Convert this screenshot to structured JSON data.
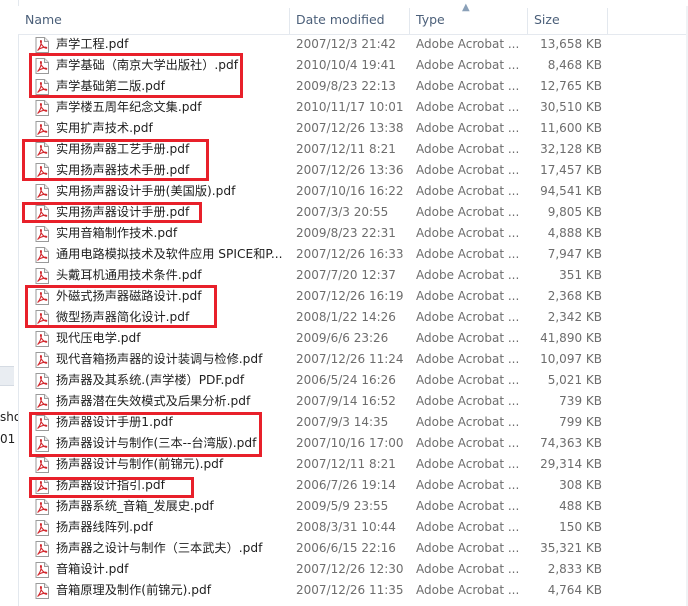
{
  "left_pane": {
    "fragment_1": "sho",
    "fragment_2": "01"
  },
  "columns": {
    "name": "Name",
    "date": "Date modified",
    "type": "Type",
    "size": "Size"
  },
  "files": [
    {
      "name": "声学工程.pdf",
      "date": "2007/12/3 21:42",
      "type": "Adobe Acrobat ...",
      "size": "13,658 KB"
    },
    {
      "name": "声学基础（南京大学出版社）.pdf",
      "date": "2010/10/4 19:41",
      "type": "Adobe Acrobat ...",
      "size": "8,468 KB"
    },
    {
      "name": "声学基础第二版.pdf",
      "date": "2009/8/23 22:13",
      "type": "Adobe Acrobat ...",
      "size": "12,765 KB"
    },
    {
      "name": "声学楼五周年纪念文集.pdf",
      "date": "2010/11/17 10:01",
      "type": "Adobe Acrobat ...",
      "size": "30,510 KB"
    },
    {
      "name": "实用扩声技术.pdf",
      "date": "2007/12/26 13:38",
      "type": "Adobe Acrobat ...",
      "size": "11,600 KB"
    },
    {
      "name": "实用扬声器工艺手册.pdf",
      "date": "2007/12/11 8:21",
      "type": "Adobe Acrobat ...",
      "size": "32,128 KB"
    },
    {
      "name": "实用扬声器技术手册.pdf",
      "date": "2007/12/26 13:36",
      "type": "Adobe Acrobat ...",
      "size": "17,457 KB"
    },
    {
      "name": "实用扬声器设计手册(美国版).pdf",
      "date": "2007/10/16 16:22",
      "type": "Adobe Acrobat ...",
      "size": "94,541 KB"
    },
    {
      "name": "实用扬声器设计手册.pdf",
      "date": "2007/3/3 20:55",
      "type": "Adobe Acrobat ...",
      "size": "9,805 KB"
    },
    {
      "name": "实用音箱制作技术.pdf",
      "date": "2009/8/23 22:31",
      "type": "Adobe Acrobat ...",
      "size": "4,888 KB"
    },
    {
      "name": "通用电路模拟技术及软件应用 SPICE和P...",
      "date": "2007/12/26 16:33",
      "type": "Adobe Acrobat ...",
      "size": "7,947 KB"
    },
    {
      "name": "头戴耳机通用技术条件.pdf",
      "date": "2007/7/20 12:37",
      "type": "Adobe Acrobat ...",
      "size": "351 KB"
    },
    {
      "name": "外磁式扬声器磁路设计.pdf",
      "date": "2007/12/26 16:19",
      "type": "Adobe Acrobat ...",
      "size": "2,368 KB"
    },
    {
      "name": "微型扬声器简化设计.pdf",
      "date": "2008/1/22 14:26",
      "type": "Adobe Acrobat ...",
      "size": "2,342 KB"
    },
    {
      "name": "现代压电学.pdf",
      "date": "2009/6/6 23:26",
      "type": "Adobe Acrobat ...",
      "size": "41,890 KB"
    },
    {
      "name": "现代音箱扬声器的设计装调与检修.pdf",
      "date": "2007/12/26 11:24",
      "type": "Adobe Acrobat ...",
      "size": "10,097 KB"
    },
    {
      "name": "扬声器及其系统.(声学楼）PDF.pdf",
      "date": "2006/5/24 16:26",
      "type": "Adobe Acrobat ...",
      "size": "5,021 KB"
    },
    {
      "name": "扬声器潜在失效模式及后果分析.pdf",
      "date": "2007/9/14 16:52",
      "type": "Adobe Acrobat ...",
      "size": "739 KB"
    },
    {
      "name": "扬声器设计手册1.pdf",
      "date": "2007/9/3 14:35",
      "type": "Adobe Acrobat ...",
      "size": "799 KB"
    },
    {
      "name": "扬声器设计与制作(三本--台湾版).pdf",
      "date": "2007/10/16 17:00",
      "type": "Adobe Acrobat ...",
      "size": "74,363 KB"
    },
    {
      "name": "扬声器设计与制作(前锦元).pdf",
      "date": "2007/12/11 8:21",
      "type": "Adobe Acrobat ...",
      "size": "29,314 KB"
    },
    {
      "name": "扬声器设计指引.pdf",
      "date": "2006/7/26 19:14",
      "type": "Adobe Acrobat ...",
      "size": "308 KB"
    },
    {
      "name": "扬声器系统_音箱_发展史.pdf",
      "date": "2009/5/9 23:55",
      "type": "Adobe Acrobat ...",
      "size": "488 KB"
    },
    {
      "name": "扬声器线阵列.pdf",
      "date": "2008/3/31 10:44",
      "type": "Adobe Acrobat ...",
      "size": "150 KB"
    },
    {
      "name": "扬声器之设计与制作（三本武夫）.pdf",
      "date": "2006/6/15 22:16",
      "type": "Adobe Acrobat ...",
      "size": "35,321 KB"
    },
    {
      "name": "音箱设计.pdf",
      "date": "2007/12/26 12:30",
      "type": "Adobe Acrobat ...",
      "size": "2,833 KB"
    },
    {
      "name": "音箱原理及制作(前锦元).pdf",
      "date": "2007/12/26 11:35",
      "type": "Adobe Acrobat ...",
      "size": "4,764 KB"
    }
  ],
  "highlight_color": "#e8202a",
  "icon": "pdf-file-icon"
}
